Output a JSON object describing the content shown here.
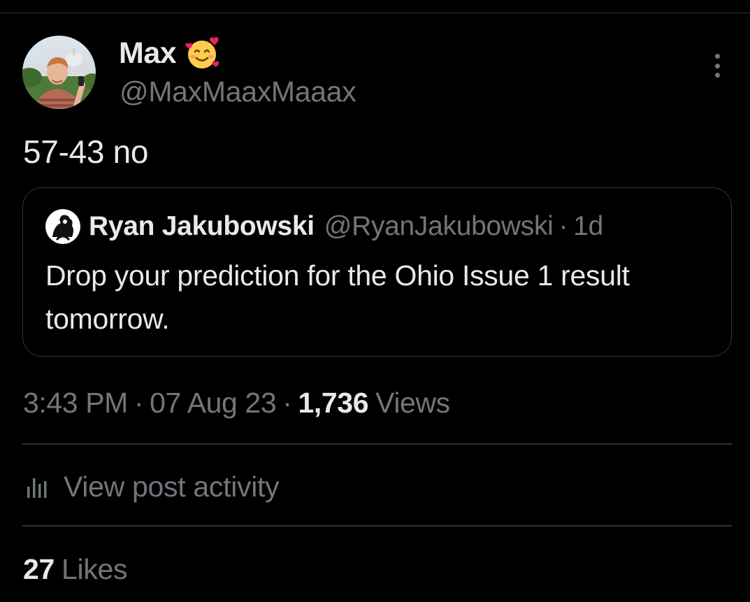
{
  "post": {
    "author": {
      "display_name": "Max",
      "handle": "@MaxMaaxMaaax",
      "avatar": "avatar-photo",
      "name_emoji": "smiling-face-with-hearts-icon"
    },
    "text": "57-43 no",
    "quoted_post": {
      "author_name": "Ryan Jakubowski",
      "author_handle": "@RyanJakubowski",
      "separator": "·",
      "time": "1d",
      "text": "Drop your prediction for the Ohio Issue 1 result tomorrow."
    },
    "meta": {
      "time": "3:43 PM",
      "separator": "·",
      "date": "07 Aug 23",
      "views_count": "1,736",
      "views_label": "Views"
    },
    "activity": {
      "label": "View post activity",
      "icon": "analytics-bars-icon"
    },
    "likes": {
      "count": "27",
      "label": "Likes"
    },
    "more_icon": "more-options-icon"
  },
  "colors": {
    "background": "#000000",
    "text_primary": "#e7e9ea",
    "text_secondary": "#71767b",
    "divider": "#2f3336"
  }
}
